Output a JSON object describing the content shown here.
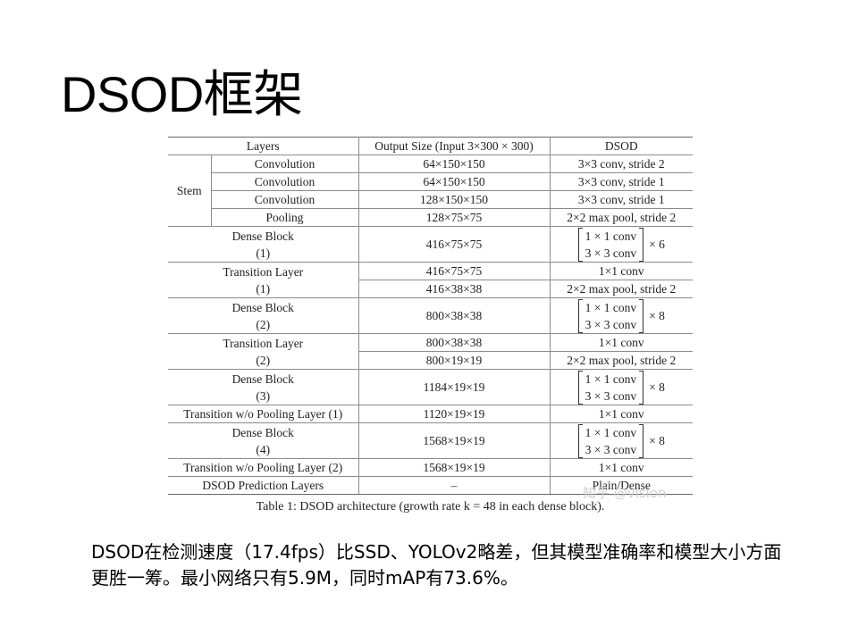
{
  "title": "DSOD框架",
  "table": {
    "headers": [
      "Layers",
      "Output Size (Input 3×300 × 300)",
      "DSOD"
    ],
    "stem_label": "Stem",
    "stem_rows": [
      {
        "layer": "Convolution",
        "output": "64×150×150",
        "dsod": "3×3 conv, stride 2"
      },
      {
        "layer": "Convolution",
        "output": "64×150×150",
        "dsod": "3×3 conv, stride 1"
      },
      {
        "layer": "Convolution",
        "output": "128×150×150",
        "dsod": "3×3 conv, stride 1"
      },
      {
        "layer": "Pooling",
        "output": "128×75×75",
        "dsod": "2×2 max pool, stride 2"
      }
    ],
    "dense1": {
      "name": "Dense Block",
      "index": "(1)",
      "output": "416×75×75",
      "m1": "1 × 1 conv",
      "m2": "3 × 3 conv",
      "mult": "× 6"
    },
    "trans1": {
      "name": "Transition Layer",
      "index": "(1)",
      "out_a": "416×75×75",
      "dsod_a": "1×1 conv",
      "out_b": "416×38×38",
      "dsod_b": "2×2 max pool, stride 2"
    },
    "dense2": {
      "name": "Dense Block",
      "index": "(2)",
      "output": "800×38×38",
      "m1": "1 × 1 conv",
      "m2": "3 × 3 conv",
      "mult": "× 8"
    },
    "trans2": {
      "name": "Transition Layer",
      "index": "(2)",
      "out_a": "800×38×38",
      "dsod_a": "1×1 conv",
      "out_b": "800×19×19",
      "dsod_b": "2×2 max pool, stride 2"
    },
    "dense3": {
      "name": "Dense Block",
      "index": "(3)",
      "output": "1184×19×19",
      "m1": "1 × 1 conv",
      "m2": "3 × 3 conv",
      "mult": "× 8"
    },
    "trans_nopool1": {
      "name": "Transition w/o Pooling Layer (1)",
      "output": "1120×19×19",
      "dsod": "1×1 conv"
    },
    "dense4": {
      "name": "Dense Block",
      "index": "(4)",
      "output": "1568×19×19",
      "m1": "1 × 1 conv",
      "m2": "3 × 3 conv",
      "mult": "× 8"
    },
    "trans_nopool2": {
      "name": "Transition w/o Pooling Layer (2)",
      "output": "1568×19×19",
      "dsod": "1×1 conv"
    },
    "prediction": {
      "name": "DSOD Prediction Layers",
      "output": "–",
      "dsod": "Plain/Dense"
    },
    "caption": "Table 1: DSOD architecture (growth rate k = 48 in each dense block)."
  },
  "watermark": "知乎 @vision",
  "note": "DSOD在检测速度（17.4fps）比SSD、YOLOv2略差，但其模型准确率和模型大小方面更胜一筹。最小网络只有5.9M，同时mAP有73.6%。"
}
